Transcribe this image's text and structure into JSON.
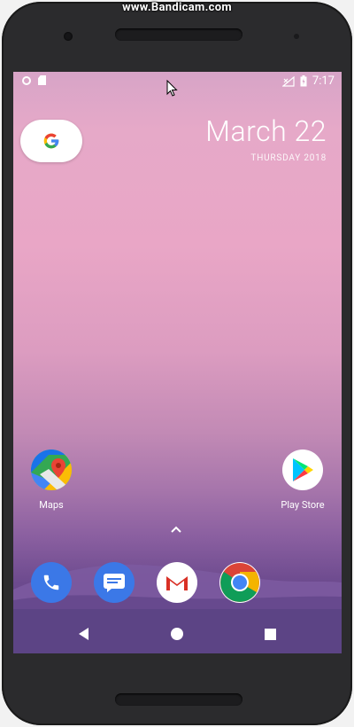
{
  "watermark": "www.Bandicam.com",
  "status_bar": {
    "left_icons": [
      "notification-dot-icon",
      "sd-card-icon"
    ],
    "right_icons": [
      "no-signal-icon",
      "battery-icon"
    ],
    "time": "7:17"
  },
  "search_widget": {
    "logo_text": "G",
    "colors": {
      "g_blue": "#4285F4",
      "g_red": "#EA4335",
      "g_yellow": "#FBBC05",
      "g_green": "#34A853"
    }
  },
  "date_widget": {
    "date": "March 22",
    "day": "THURSDAY 2018"
  },
  "home_apps": [
    {
      "label": "Maps",
      "icon": "maps-icon"
    },
    {
      "label": "Play Store",
      "icon": "play-store-icon"
    }
  ],
  "app_drawer_hint": "^",
  "dock": [
    {
      "icon": "phone-icon",
      "color": "#3367D6"
    },
    {
      "icon": "messages-icon",
      "color": "#3367D6"
    },
    {
      "icon": "gmail-icon",
      "color": "#ffffff"
    },
    {
      "icon": "chrome-icon",
      "color": "#ffffff"
    }
  ],
  "nav": [
    "back-icon",
    "home-icon",
    "recents-icon"
  ]
}
